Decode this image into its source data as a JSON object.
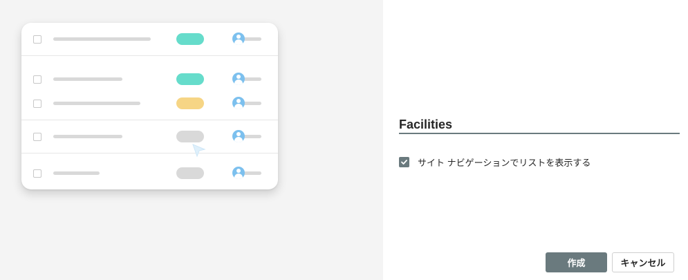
{
  "preview": {
    "rows": [
      {
        "pill_color": "#66dccb"
      },
      {
        "pill_color": "#66dccb"
      },
      {
        "pill_color": "#f6d585"
      },
      {
        "pill_color": "#d9d9d9"
      },
      {
        "pill_color": "#d9d9d9"
      }
    ],
    "avatar_color": "#7cc0ee",
    "cursor_icon": "pointer-cursor-icon"
  },
  "settings": {
    "name_value": "Facilities",
    "show_in_nav_label": "サイト ナビゲーションでリストを表示する",
    "show_in_nav_checked": true,
    "create_label": "作成",
    "cancel_label": "キャンセル",
    "accent_color": "#6a7a7e"
  }
}
